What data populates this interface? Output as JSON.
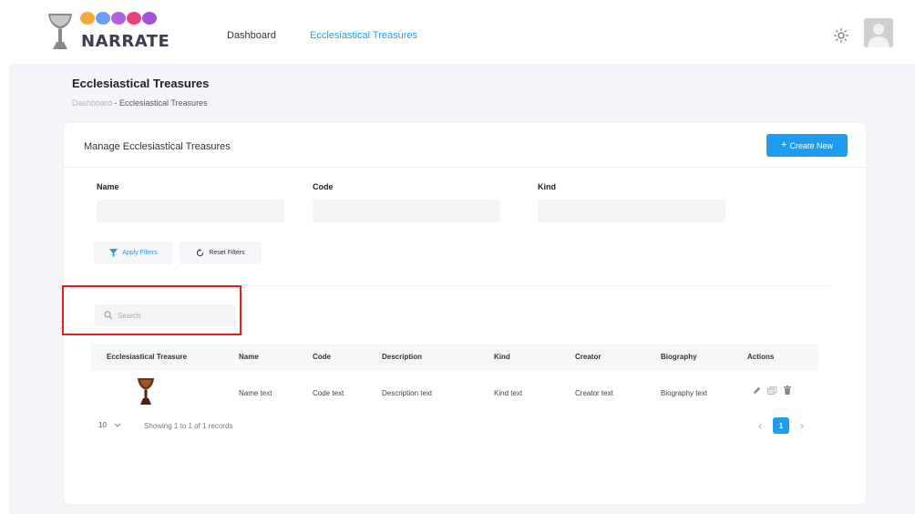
{
  "brand": {
    "name": "NARRATE",
    "dot_colors": [
      "#f2a93b",
      "#6c9ef7",
      "#b35fe6",
      "#e8407a",
      "#a64fd9"
    ],
    "cup_icon": "chalice-icon"
  },
  "nav": {
    "items": [
      {
        "label": "Dashboard",
        "active": false
      },
      {
        "label": "Ecclesiastical Treasures",
        "active": true
      }
    ]
  },
  "header": {
    "theme_icon": "sun-icon",
    "avatar_icon": "user-avatar"
  },
  "page": {
    "title": "Ecclesiastical Treasures",
    "breadcrumb": {
      "root": "Dashboard",
      "sep": " - ",
      "current": "Ecclesiastical Treasures"
    }
  },
  "card": {
    "title": "Manage Ecclesiastical Treasures",
    "create_button": "Create New"
  },
  "filters": {
    "fields": [
      {
        "label": "Name",
        "value": ""
      },
      {
        "label": "Code",
        "value": ""
      },
      {
        "label": "Kind",
        "value": ""
      }
    ],
    "apply_label": "Apply Filters",
    "reset_label": "Reset Filters"
  },
  "search": {
    "placeholder": "Search"
  },
  "table": {
    "columns": [
      "Ecclesiastical Treasure",
      "Name",
      "Code",
      "Description",
      "Kind",
      "Creator",
      "Biography",
      "Actions"
    ],
    "rows": [
      {
        "image_icon": "chalice-thumbnail",
        "name": "Name text",
        "code": "Code text",
        "description": "Description text",
        "kind": "Kind text",
        "creator": "Creator text",
        "biography": "Biography text"
      }
    ]
  },
  "pagination": {
    "page_size": "10",
    "showing": "Showing 1 to 1 of 1 records",
    "current_page": "1"
  },
  "colors": {
    "accent": "#1e9cf0",
    "highlight": "#e02020",
    "background": "#f4f5f8"
  }
}
